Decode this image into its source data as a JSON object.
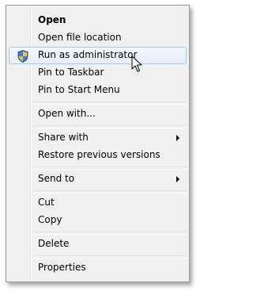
{
  "menu": {
    "items": [
      {
        "label": "Open"
      },
      {
        "label": "Open file location"
      },
      {
        "label": "Run as administrator"
      },
      {
        "label": "Pin to Taskbar"
      },
      {
        "label": "Pin to Start Menu"
      },
      {
        "label": "Open with..."
      },
      {
        "label": "Share with"
      },
      {
        "label": "Restore previous versions"
      },
      {
        "label": "Send to"
      },
      {
        "label": "Cut"
      },
      {
        "label": "Copy"
      },
      {
        "label": "Delete"
      },
      {
        "label": "Properties"
      }
    ]
  },
  "icons": {
    "admin": "uac-shield-icon",
    "submenu": "submenu-arrow-icon",
    "cursor": "mouse-pointer-icon"
  },
  "colors": {
    "hover_border": "#a8c8ec",
    "menu_background": "#f0f0f0"
  }
}
